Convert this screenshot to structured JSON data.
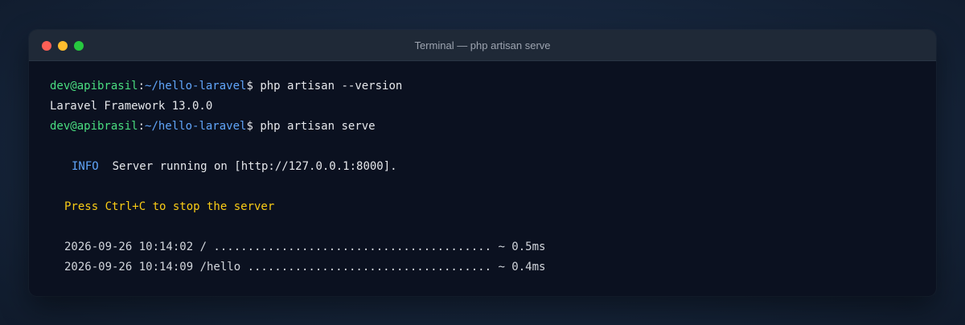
{
  "window": {
    "title": "Terminal — php artisan serve"
  },
  "terminal": {
    "prompt_user": "dev@apibrasil",
    "prompt_sep": ":",
    "prompt_path": "~/hello-laravel",
    "prompt_symbol": "$ ",
    "commands": [
      "php artisan --version",
      "php artisan serve"
    ],
    "version_output": "Laravel Framework 13.0.0",
    "info_label": "INFO",
    "info_message": "  Server running on [http://127.0.0.1:8000].",
    "stop_hint": "Press Ctrl+C to stop the server",
    "requests": [
      "2026-09-26 10:14:02 / ......................................... ~ 0.5ms",
      "2026-09-26 10:14:09 /hello .................................... ~ 0.4ms"
    ]
  },
  "colors": {
    "user": "#4ade80",
    "path": "#60a5fa",
    "info": "#60a5fa",
    "warning": "#facc15",
    "close": "#ff5f56",
    "minimize": "#ffbd2e",
    "maximize": "#27c93f"
  }
}
